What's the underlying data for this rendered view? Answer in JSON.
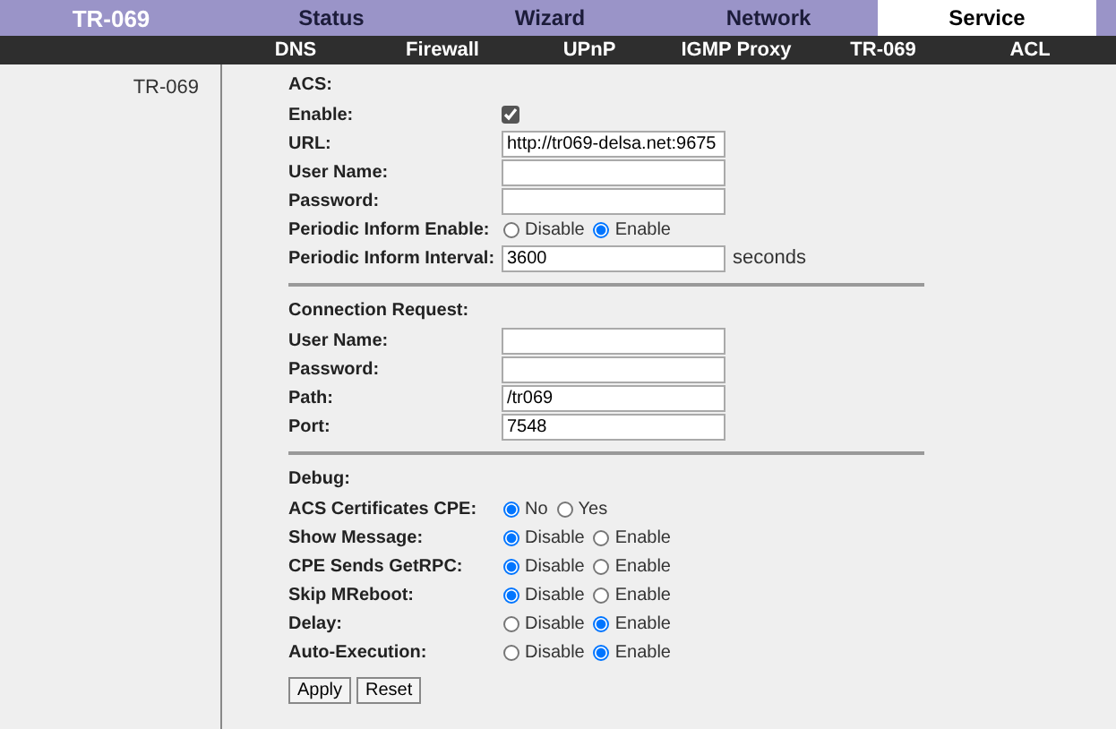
{
  "brand": "TR-069",
  "tabs": [
    {
      "label": "Status",
      "selected": false
    },
    {
      "label": "Wizard",
      "selected": false
    },
    {
      "label": "Network",
      "selected": false
    },
    {
      "label": "Service",
      "selected": true
    }
  ],
  "subnav": [
    {
      "label": "DNS"
    },
    {
      "label": "Firewall"
    },
    {
      "label": "UPnP"
    },
    {
      "label": "IGMP Proxy"
    },
    {
      "label": "TR-069"
    },
    {
      "label": "ACL"
    }
  ],
  "sidebar": {
    "items": [
      {
        "label": "TR-069"
      }
    ]
  },
  "sections": [
    {
      "title": "ACS:",
      "fields": [
        {
          "kind": "checkbox",
          "label": "Enable:",
          "checked": true
        },
        {
          "kind": "text",
          "label": "URL:",
          "value": "http://tr069-delsa.net:9675"
        },
        {
          "kind": "text",
          "label": "User Name:"
        },
        {
          "kind": "text",
          "label": "Password:"
        },
        {
          "kind": "radio",
          "label": "Periodic Inform Enable:",
          "options": [
            {
              "label": "Disable",
              "selected": false
            },
            {
              "label": "Enable",
              "selected": true
            }
          ]
        },
        {
          "kind": "text",
          "label": "Periodic Inform Interval:",
          "value": "3600",
          "suffix": "seconds"
        }
      ]
    },
    {
      "title": "Connection Request:",
      "fields": [
        {
          "kind": "text",
          "label": "User Name:"
        },
        {
          "kind": "text",
          "label": "Password:"
        },
        {
          "kind": "text",
          "label": "Path:",
          "value": "/tr069"
        },
        {
          "kind": "text",
          "label": "Port:",
          "value": "7548"
        }
      ]
    },
    {
      "title": "Debug:",
      "fields": [
        {
          "kind": "radio",
          "label": "ACS Certificates CPE:",
          "options": [
            {
              "label": "No",
              "selected": true
            },
            {
              "label": "Yes",
              "selected": false
            }
          ]
        },
        {
          "kind": "radio",
          "label": "Show Message:",
          "options": [
            {
              "label": "Disable",
              "selected": true
            },
            {
              "label": "Enable",
              "selected": false
            }
          ]
        },
        {
          "kind": "radio",
          "label": "CPE Sends GetRPC:",
          "options": [
            {
              "label": "Disable",
              "selected": true
            },
            {
              "label": "Enable",
              "selected": false
            }
          ]
        },
        {
          "kind": "radio",
          "label": "Skip MReboot:",
          "options": [
            {
              "label": "Disable",
              "selected": true
            },
            {
              "label": "Enable",
              "selected": false
            }
          ]
        },
        {
          "kind": "radio",
          "label": "Delay:",
          "options": [
            {
              "label": "Disable",
              "selected": false
            },
            {
              "label": "Enable",
              "selected": true
            }
          ]
        },
        {
          "kind": "radio",
          "label": "Auto-Execution:",
          "options": [
            {
              "label": "Disable",
              "selected": false
            },
            {
              "label": "Enable",
              "selected": true
            }
          ]
        }
      ]
    }
  ],
  "buttons": [
    "Apply",
    "Reset"
  ]
}
